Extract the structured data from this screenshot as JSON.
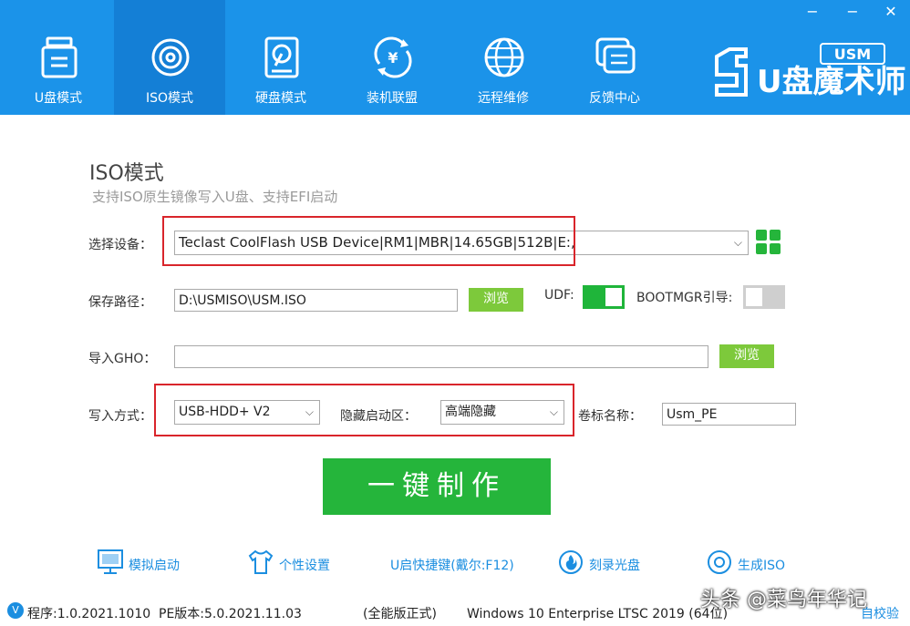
{
  "window": {
    "minimize": "−",
    "restore": "−",
    "close": "✕"
  },
  "nav": [
    {
      "label": "U盘模式",
      "icon": "usb-drive-icon"
    },
    {
      "label": "ISO模式",
      "icon": "disc-icon"
    },
    {
      "label": "硬盘模式",
      "icon": "hard-disk-icon"
    },
    {
      "label": "装机联盟",
      "icon": "yen-refresh-icon"
    },
    {
      "label": "远程维修",
      "icon": "globe-icon"
    },
    {
      "label": "反馈中心",
      "icon": "chat-icon"
    }
  ],
  "logo": {
    "text": "U盘魔术师",
    "badge": "USM"
  },
  "page": {
    "title": "ISO模式",
    "subtitle": "支持ISO原生镜像写入U盘、支持EFI启动"
  },
  "device": {
    "label": "选择设备：",
    "value": "Teclast CoolFlash USB Device|RM1|MBR|14.65GB|512B|E:,"
  },
  "save_path": {
    "label": "保存路径：",
    "value": "D:\\USMISO\\USM.ISO",
    "browse": "浏览"
  },
  "udf": {
    "label": "UDF:",
    "on": true
  },
  "bootmgr": {
    "label": "BOOTMGR引导:",
    "on": false
  },
  "gho": {
    "label": "导入GHO：",
    "value": "",
    "browse": "浏览"
  },
  "write_mode": {
    "label": "写入方式：",
    "value": "USB-HDD+ V2"
  },
  "hidden_partition": {
    "label": "隐藏启动区：",
    "value": "高端隐藏"
  },
  "volume": {
    "label": "卷标名称：",
    "value": "Usm_PE"
  },
  "make_button": "一键制作",
  "bottom": [
    {
      "label": "模拟启动",
      "icon": "monitor-icon"
    },
    {
      "label": "个性设置",
      "icon": "tshirt-icon"
    },
    {
      "label": "U启快捷键(戴尔:F12)",
      "icon": ""
    },
    {
      "label": "刻录光盘",
      "icon": "burn-disc-icon"
    },
    {
      "label": "生成ISO",
      "icon": "iso-disc-icon"
    }
  ],
  "status": {
    "ver_icon": "V",
    "program": "程序:1.0.2021.1010",
    "pe": "PE版本:5.0.2021.11.03",
    "edition": "(全能版正式)",
    "os": "Windows 10 Enterprise LTSC 2019 (64位)",
    "self_check": "自校验"
  },
  "watermark": "头条 @菜鸟年华记",
  "colors": {
    "header_blue": "#1b93e9",
    "active_tab": "#147fd6",
    "button_green": "#7dc93b",
    "main_green": "#25b53b",
    "toggle_green": "#1fb53a",
    "highlight_red": "#d9252b",
    "link_blue": "#1b8ee0"
  }
}
